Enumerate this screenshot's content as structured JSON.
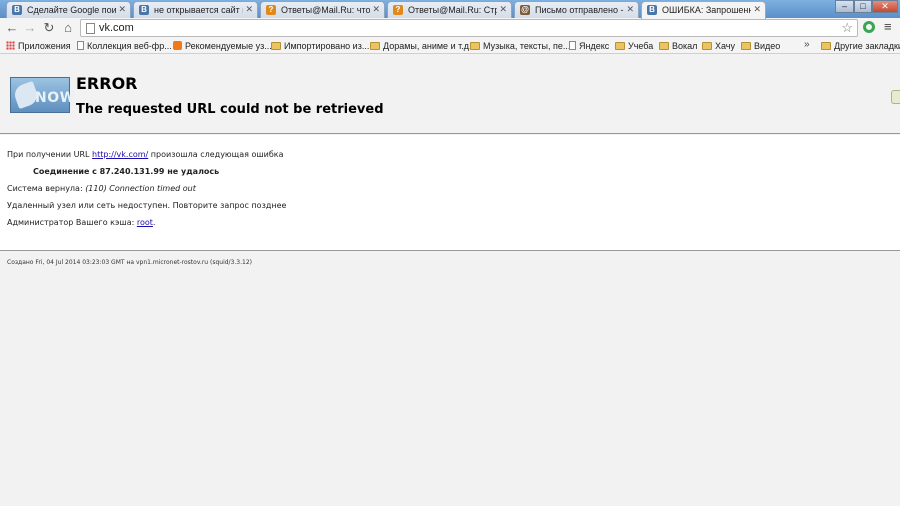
{
  "tabs": [
    {
      "title": "Сделайте Google поиско",
      "icon": "vk-icon"
    },
    {
      "title": "не открывается сайт вкс",
      "icon": "vk-icon"
    },
    {
      "title": "Ответы@Mail.Ru: что де",
      "icon": "mail-answers-icon"
    },
    {
      "title": "Ответы@Mail.Ru: Стран",
      "icon": "mail-answers-icon"
    },
    {
      "title": "Письмо отправлено - от",
      "icon": "mailbox-icon"
    },
    {
      "title": "ОШИБКА: Запрошенный",
      "icon": "vk-icon",
      "active": true
    }
  ],
  "window_controls": {
    "minimize": "–",
    "maximize": "□",
    "close": "✕"
  },
  "toolbar": {
    "back": "←",
    "forward": "→",
    "reload": "↻",
    "home": "⌂",
    "url": "vk.com",
    "star": "☆",
    "menu": "≡"
  },
  "bookmarks": {
    "items": [
      {
        "label": "Приложения",
        "icon": "apps-icon"
      },
      {
        "label": "Коллекция веб-фр...",
        "icon": "page-icon"
      },
      {
        "label": "Рекомендуемые уз...",
        "icon": "orange-icon"
      },
      {
        "label": "Импортировано из...",
        "icon": "folder-icon"
      },
      {
        "label": "Дорамы, аниме и т.д.",
        "icon": "folder-icon"
      },
      {
        "label": "Музыка, тексты, пе...",
        "icon": "folder-icon"
      },
      {
        "label": "Яндекс",
        "icon": "page-icon"
      },
      {
        "label": "Учеба",
        "icon": "folder-icon"
      },
      {
        "label": "Вокал",
        "icon": "folder-icon"
      },
      {
        "label": "Хачу",
        "icon": "folder-icon"
      },
      {
        "label": "Видео",
        "icon": "folder-icon"
      }
    ],
    "overflow": "»",
    "other": "Другие закладки"
  },
  "error": {
    "logo_text": "NOW",
    "title": "ERROR",
    "subtitle": "The requested URL could not be retrieved",
    "line1_prefix": "При получении URL ",
    "line1_link": "http://vk.com/",
    "line1_suffix": " произошла следующая ошибка",
    "line2": "Соединение с 87.240.131.99 не удалось",
    "line3_prefix": "Система вернула: ",
    "line3_italic": "(110) Connection timed out",
    "line4": "Удаленный узел или сеть недоступен. Повторите запрос позднее",
    "line5_prefix": "Администратор Вашего кэша: ",
    "line5_link": "root",
    "line5_suffix": ".",
    "footer": "Создано Fri, 04 Jul 2014 03:23:03 GMT на vpn1.micronet-rostov.ru (squid/3.3.12)"
  }
}
